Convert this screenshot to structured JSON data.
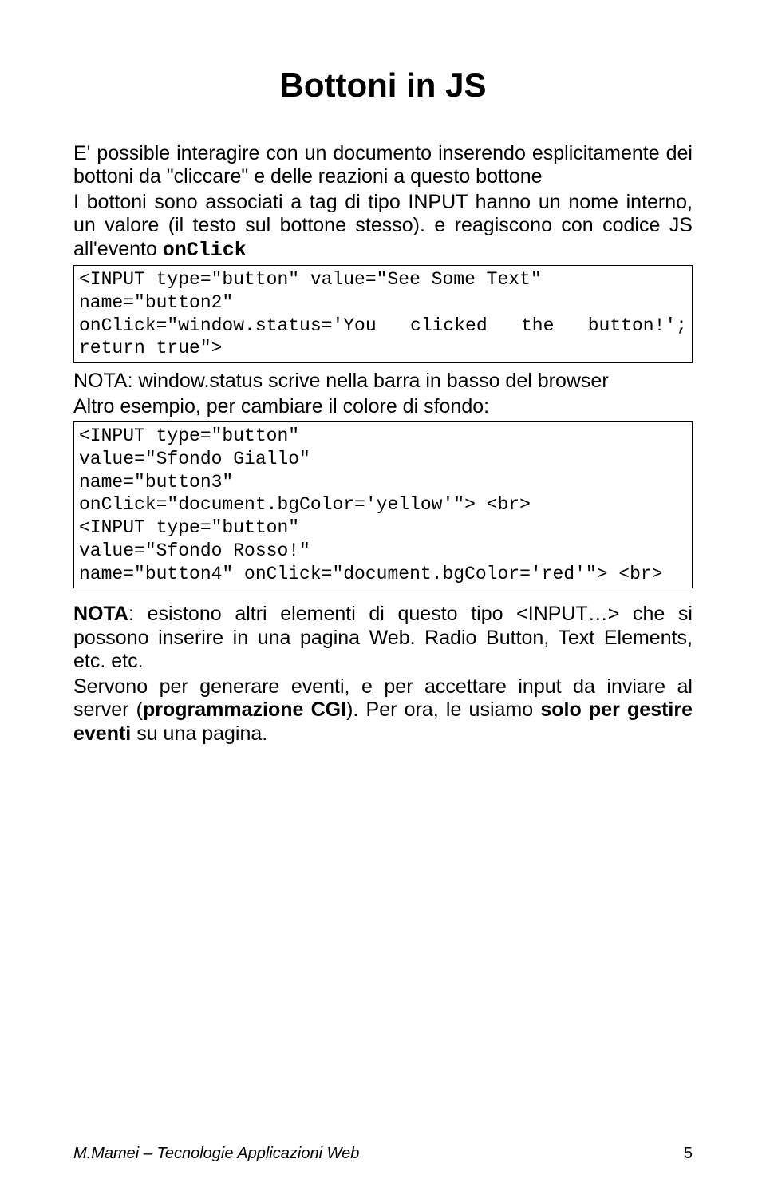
{
  "title": "Bottoni in JS",
  "para1": "E' possible interagire con un documento inserendo esplicitamente dei bottoni da \"cliccare\" e delle reazioni a questo bottone",
  "para2": "I bottoni sono associati a tag di tipo INPUT hanno un nome interno, un valore (il testo sul bottone stesso). e reagiscono con codice JS all'evento ",
  "onclick": "onClick",
  "code1": {
    "l1": "<INPUT type=\"button\" value=\"See Some Text\"",
    "l2": "name=\"button2\"",
    "l3a": "onClick=\"window.status='You",
    "l3b": "clicked",
    "l3c": "the",
    "l3d": "button!';",
    "l4": "return true\">"
  },
  "para3": "NOTA: window.status scrive nella barra in basso del browser",
  "para4": "Altro esempio, per cambiare il colore di sfondo:",
  "code2": {
    "l1": "<INPUT type=\"button\"",
    "l2": "value=\"Sfondo Giallo\"",
    "l3": "name=\"button3\"",
    "l4": "onClick=\"document.bgColor='yellow'\"> <br>",
    "l5": "<INPUT type=\"button\"",
    "l6": "value=\"Sfondo Rosso!\"",
    "l7": "name=\"button4\" onClick=\"document.bgColor='red'\"> <br>"
  },
  "nota": "NOTA",
  "para5a": ": esistono altri elementi di questo tipo <INPUT…> che si possono inserire in una pagina Web. Radio Button, Text Elements, etc. etc.",
  "para6a": "Servono per generare eventi, e per accettare input da inviare al server (",
  "cgi": "programmazione CGI",
  "para6b": "). Per ora",
  "comma": ", le usiamo ",
  "solo": "solo per gestire eventi",
  "end": " su una pagina.",
  "footer_left": "M.Mamei – Tecnologie Applicazioni Web",
  "footer_page": "5"
}
